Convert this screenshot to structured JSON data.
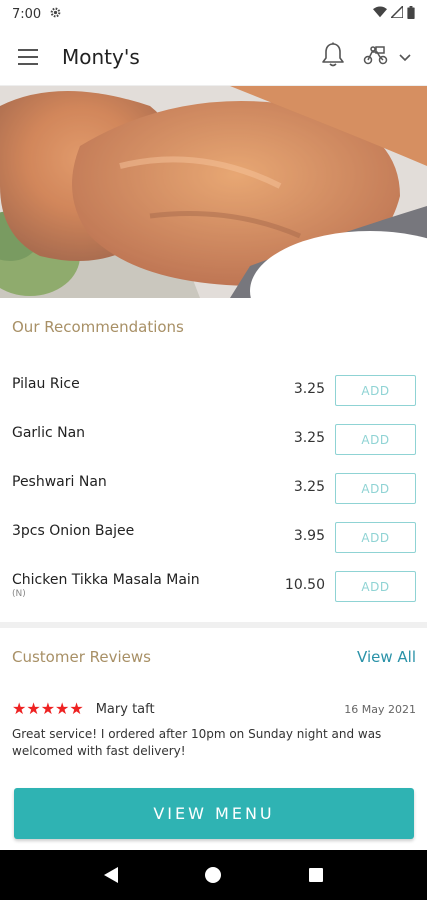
{
  "status_bar": {
    "time": "7:00"
  },
  "app_bar": {
    "title": "Monty's"
  },
  "recommendations": {
    "title": "Our Recommendations",
    "add_label": "ADD",
    "items": [
      {
        "name": "Pilau Rice",
        "price": "3.25",
        "note": ""
      },
      {
        "name": "Garlic Nan",
        "price": "3.25",
        "note": ""
      },
      {
        "name": "Peshwari Nan",
        "price": "3.25",
        "note": ""
      },
      {
        "name": "3pcs Onion Bajee",
        "price": "3.95",
        "note": ""
      },
      {
        "name": "Chicken Tikka Masala Main",
        "price": "10.50",
        "note": "(N)"
      }
    ]
  },
  "reviews": {
    "title": "Customer Reviews",
    "view_all": "View All",
    "items": [
      {
        "rating": 5,
        "stars": "★★★★★",
        "reviewer": "Mary taft",
        "date": "16 May 2021",
        "text": "Great service! I ordered after 10pm on Sunday night and was welcomed with fast delivery!"
      }
    ]
  },
  "view_menu_label": "VIEW MENU",
  "colors": {
    "accent": "#2fb3b3",
    "section_title": "#a89066",
    "link": "#2a92a8",
    "star": "#e22222",
    "add_border": "#8fd3d4"
  },
  "icons": {
    "menu": "hamburger-icon",
    "notifications": "bell-icon",
    "delivery": "scooter-icon",
    "dropdown": "chevron-down-icon",
    "settings": "gear-icon",
    "wifi": "wifi-icon",
    "signal": "signal-icon",
    "battery": "battery-icon"
  }
}
